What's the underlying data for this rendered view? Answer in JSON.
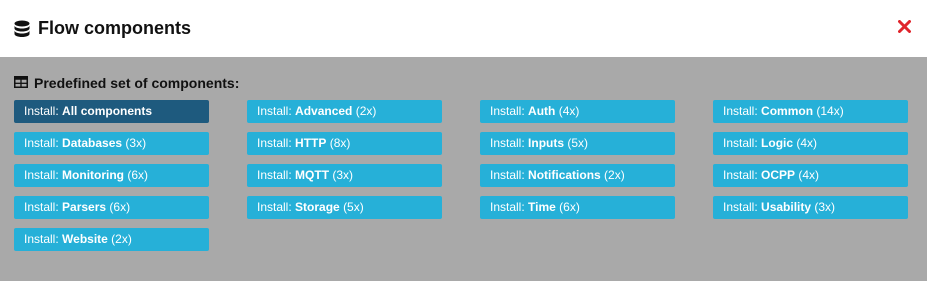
{
  "header": {
    "title": "Flow components",
    "icon": "database-icon",
    "close_icon": "close-icon",
    "close_color": "#e0242b"
  },
  "section": {
    "title": "Predefined set of components:",
    "icon": "table-icon"
  },
  "colors": {
    "button": "#26b0d8",
    "button_active": "#1e5a7e",
    "backdrop": "#a9a9a9"
  },
  "buttons": [
    {
      "prefix": "Install:",
      "name": "All components",
      "count": ""
    },
    {
      "prefix": "Install:",
      "name": "Advanced",
      "count": "(2x)"
    },
    {
      "prefix": "Install:",
      "name": "Auth",
      "count": "(4x)"
    },
    {
      "prefix": "Install:",
      "name": "Common",
      "count": "(14x)"
    },
    {
      "prefix": "Install:",
      "name": "Databases",
      "count": "(3x)"
    },
    {
      "prefix": "Install:",
      "name": "HTTP",
      "count": "(8x)"
    },
    {
      "prefix": "Install:",
      "name": "Inputs",
      "count": "(5x)"
    },
    {
      "prefix": "Install:",
      "name": "Logic",
      "count": "(4x)"
    },
    {
      "prefix": "Install:",
      "name": "Monitoring",
      "count": "(6x)"
    },
    {
      "prefix": "Install:",
      "name": "MQTT",
      "count": "(3x)"
    },
    {
      "prefix": "Install:",
      "name": "Notifications",
      "count": "(2x)"
    },
    {
      "prefix": "Install:",
      "name": "OCPP",
      "count": "(4x)"
    },
    {
      "prefix": "Install:",
      "name": "Parsers",
      "count": "(6x)"
    },
    {
      "prefix": "Install:",
      "name": "Storage",
      "count": "(5x)"
    },
    {
      "prefix": "Install:",
      "name": "Time",
      "count": "(6x)"
    },
    {
      "prefix": "Install:",
      "name": "Usability",
      "count": "(3x)"
    },
    {
      "prefix": "Install:",
      "name": "Website",
      "count": "(2x)"
    }
  ]
}
